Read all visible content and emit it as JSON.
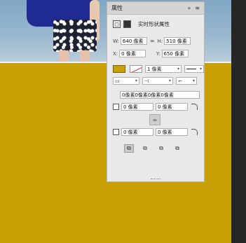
{
  "panel": {
    "title": "属性",
    "collapse_icon": "»",
    "menu_icon": "≡",
    "section_title": "实时形状属性",
    "w_label": "W:",
    "w_value": "640 像素",
    "h_label": "H:",
    "h_value": "510 像素",
    "x_label": "X:",
    "x_value": "0 像素",
    "y_label": "Y:",
    "y_value": "650 像素",
    "link_glyph": "∞",
    "fill_color": "#c9a006",
    "stroke_width": "1 像素",
    "corner_summary": "0像素0像素0像素0像素",
    "corner_tl": "0 像素",
    "corner_tr": "0 像素",
    "corner_bl": "0 像素",
    "corner_br": "0 像素"
  }
}
